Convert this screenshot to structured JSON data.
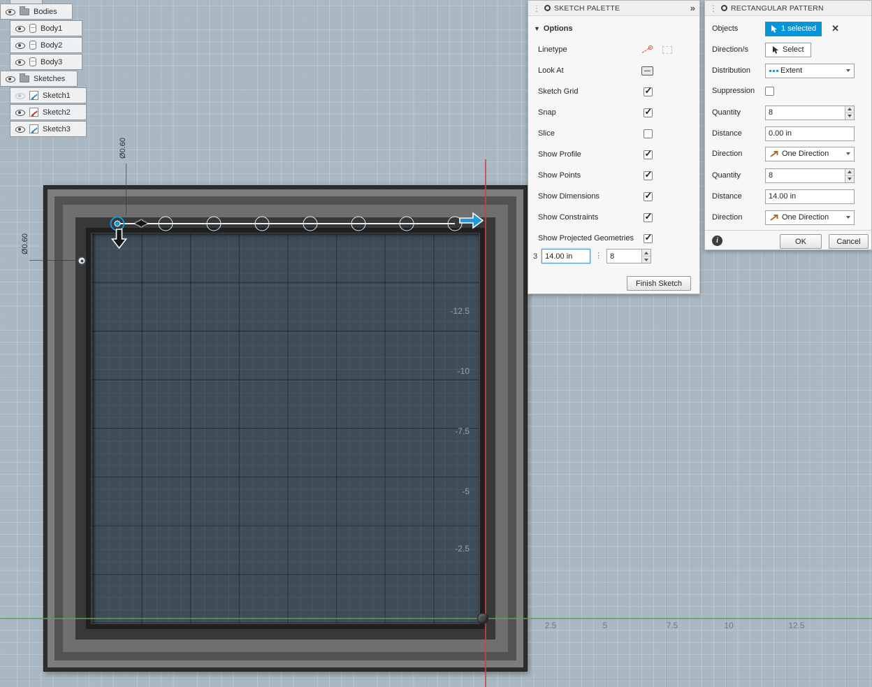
{
  "browser": {
    "bodies_folder": "Bodies",
    "bodies": [
      "Body1",
      "Body2",
      "Body3"
    ],
    "sketches_folder": "Sketches",
    "sketches": [
      "Sketch1",
      "Sketch2",
      "Sketch3"
    ]
  },
  "sketch_palette": {
    "title": "SKETCH PALETTE",
    "options_label": "Options",
    "linetype_label": "Linetype",
    "look_at_label": "Look At",
    "toggles": [
      {
        "label": "Sketch Grid",
        "checked": true
      },
      {
        "label": "Snap",
        "checked": true
      },
      {
        "label": "Slice",
        "checked": false
      },
      {
        "label": "Show Profile",
        "checked": true
      },
      {
        "label": "Show Points",
        "checked": true
      },
      {
        "label": "Show Dimensions",
        "checked": true
      },
      {
        "label": "Show Constraints",
        "checked": true
      },
      {
        "label": "Show Projected Geometries",
        "checked": true
      }
    ],
    "finish_button": "Finish Sketch"
  },
  "canvas_inputs": {
    "prefix": "3",
    "distance_value": "14.00 in",
    "quantity_value": "8"
  },
  "pattern_dialog": {
    "title": "RECTANGULAR PATTERN",
    "objects_label": "Objects",
    "objects_value": "1 selected",
    "directions_label": "Direction/s",
    "directions_value": "Select",
    "distribution_label": "Distribution",
    "distribution_value": "Extent",
    "suppression_label": "Suppression",
    "suppression_checked": false,
    "quantity1_label": "Quantity",
    "quantity1_value": "8",
    "distance1_label": "Distance",
    "distance1_value": "0.00 in",
    "direction1_label": "Direction",
    "direction1_value": "One Direction",
    "quantity2_label": "Quantity",
    "quantity2_value": "8",
    "distance2_label": "Distance",
    "distance2_value": "14.00 in",
    "direction2_label": "Direction",
    "direction2_value": "One Direction",
    "ok_label": "OK",
    "cancel_label": "Cancel"
  },
  "viewport": {
    "diameter_dim_top": "Ø0.60",
    "diameter_dim_left": "Ø0.60",
    "y_axis_labels": [
      "-12.5",
      "-10",
      "-7.5",
      "-5",
      "-2.5"
    ],
    "x_axis_labels": [
      "2.5",
      "5",
      "7.5",
      "10",
      "12.5"
    ],
    "colors": {
      "selection_blue": "#0696d7",
      "axis_red": "#c34646",
      "axis_green": "#5aa05a"
    }
  },
  "icons": {
    "close": "✕",
    "expand": "»",
    "drag_dots": "⋮",
    "flip_handles": "◀▶",
    "options_collapse": "▼",
    "info": "i"
  }
}
